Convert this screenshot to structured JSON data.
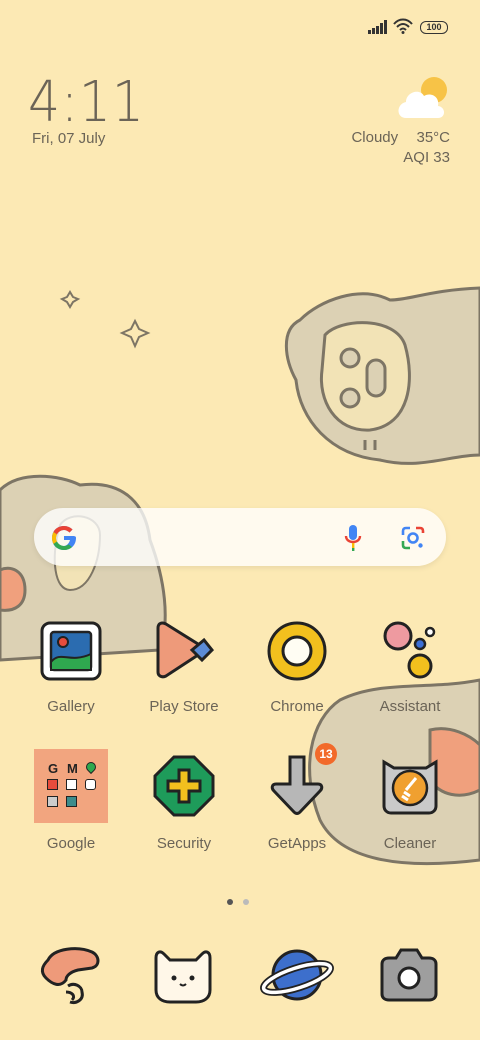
{
  "status": {
    "battery": "100",
    "icons": [
      "signal-icon",
      "wifi-icon",
      "battery-icon"
    ]
  },
  "clock": {
    "time": "4:11",
    "date": "Fri, 07 July"
  },
  "weather": {
    "condition": "Cloudy",
    "temperature": "35°C",
    "aqi": "AQI 33",
    "icon": "partly-cloudy-icon"
  },
  "search": {
    "icons": [
      "google-logo",
      "mic-icon",
      "lens-icon"
    ]
  },
  "apps_row1": [
    {
      "label": "Gallery",
      "icon": "gallery-icon"
    },
    {
      "label": "Play Store",
      "icon": "play-store-icon"
    },
    {
      "label": "Chrome",
      "icon": "chrome-icon"
    },
    {
      "label": "Assistant",
      "icon": "assistant-icon"
    }
  ],
  "apps_row2": [
    {
      "label": "Google",
      "icon": "google-folder-icon"
    },
    {
      "label": "Security",
      "icon": "security-icon"
    },
    {
      "label": "GetApps",
      "icon": "getapps-icon",
      "badge": "13"
    },
    {
      "label": "Cleaner",
      "icon": "cleaner-icon"
    }
  ],
  "folder": {
    "letters": [
      "G",
      "M"
    ]
  },
  "dock": [
    {
      "icon": "phone-icon"
    },
    {
      "icon": "messages-icon"
    },
    {
      "icon": "browser-icon"
    },
    {
      "icon": "camera-icon"
    }
  ],
  "page_indicator": {
    "pages": 2,
    "current": 1
  },
  "colors": {
    "background": "#FCE9B4",
    "text": "#6b6457",
    "badge": "#F26A2A"
  }
}
